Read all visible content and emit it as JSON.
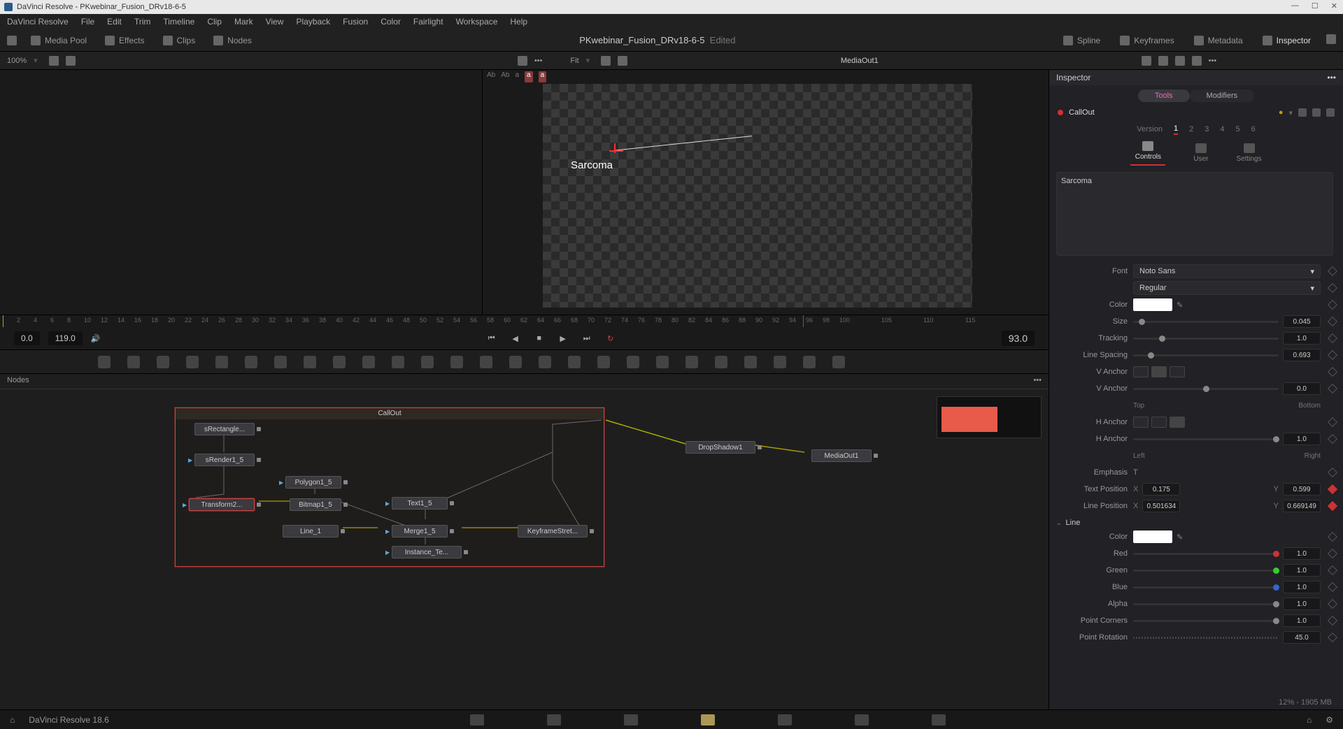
{
  "window": {
    "title": "DaVinci Resolve - PKwebinar_Fusion_DRv18-6-5"
  },
  "menu": [
    "DaVinci Resolve",
    "File",
    "Edit",
    "Trim",
    "Timeline",
    "Clip",
    "Mark",
    "View",
    "Playback",
    "Fusion",
    "Color",
    "Fairlight",
    "Workspace",
    "Help"
  ],
  "toolbar": {
    "mediaPool": "Media Pool",
    "effects": "Effects",
    "clips": "Clips",
    "nodes": "Nodes",
    "project": "PKwebinar_Fusion_DRv18-6-5",
    "edited": "Edited",
    "spline": "Spline",
    "keyframes": "Keyframes",
    "metadata": "Metadata",
    "inspector": "Inspector"
  },
  "secondbar": {
    "zoom": "100%",
    "fit": "Fit",
    "viewName": "MediaOut1"
  },
  "viewer": {
    "overlayText": "Sarcoma",
    "abLabels": [
      "Ab",
      "Ab",
      "a",
      "a",
      "a"
    ]
  },
  "ruler": {
    "ticks": [
      2,
      4,
      6,
      8,
      10,
      12,
      14,
      16,
      18,
      20,
      22,
      24,
      26,
      28,
      30,
      32,
      34,
      36,
      38,
      40,
      42,
      44,
      46,
      48,
      50,
      52,
      54,
      56,
      58,
      60,
      62,
      64,
      66,
      68,
      70,
      72,
      74,
      76,
      78,
      80,
      82,
      84,
      86,
      88,
      90,
      92,
      94,
      96,
      98,
      100,
      105,
      110,
      115
    ]
  },
  "transport": {
    "start": "0.0",
    "end": "119.0",
    "current": "93.0"
  },
  "nodesPanel": {
    "title": "Nodes",
    "group": "CallOut",
    "nodes": {
      "srect": "sRectangle...",
      "srender": "sRender1_5",
      "poly": "Polygon1_5",
      "xform": "Transform2...",
      "bitmap": "Bitmap1_5",
      "text": "Text1_5",
      "line": "Line_1",
      "merge": "Merge1_5",
      "instance": "Instance_Te...",
      "kstretch": "KeyframeStret...",
      "drop": "DropShadow1",
      "mediaout": "MediaOut1"
    }
  },
  "inspector": {
    "header": "Inspector",
    "tabs": {
      "tools": "Tools",
      "modifiers": "Modifiers"
    },
    "nodeName": "CallOut",
    "version": "Version",
    "versions": [
      "1",
      "2",
      "3",
      "4",
      "5",
      "6"
    ],
    "subtabs": {
      "controls": "Controls",
      "user": "User",
      "settings": "Settings"
    },
    "text": "Sarcoma",
    "font": {
      "label": "Font",
      "family": "Noto Sans",
      "style": "Regular"
    },
    "color": {
      "label": "Color"
    },
    "size": {
      "label": "Size",
      "value": "0.045"
    },
    "tracking": {
      "label": "Tracking",
      "value": "1.0"
    },
    "lineSpacing": {
      "label": "Line Spacing",
      "value": "0.693"
    },
    "vAnchor": {
      "label": "V Anchor",
      "top": "Top",
      "bottom": "Bottom",
      "value": "0.0"
    },
    "hAnchor": {
      "label": "H Anchor",
      "left": "Left",
      "right": "Right",
      "value": "1.0"
    },
    "emphasis": {
      "label": "Emphasis"
    },
    "textPos": {
      "label": "Text Position",
      "x": "0.175",
      "y": "0.599"
    },
    "linePos": {
      "label": "Line Position",
      "x": "0.501634",
      "y": "0.669149"
    },
    "line": {
      "label": "Line",
      "color": "Color",
      "red": "Red",
      "green": "Green",
      "blue": "Blue",
      "alpha": "Alpha",
      "rv": "1.0",
      "gv": "1.0",
      "bv": "1.0",
      "av": "1.0",
      "pointCorners": "Point Corners",
      "pcv": "1.0",
      "pointRotation": "Point Rotation",
      "prv": "45.0"
    }
  },
  "footer": {
    "app": "DaVinci Resolve 18.6"
  },
  "stats": "12% - 1905 MB"
}
